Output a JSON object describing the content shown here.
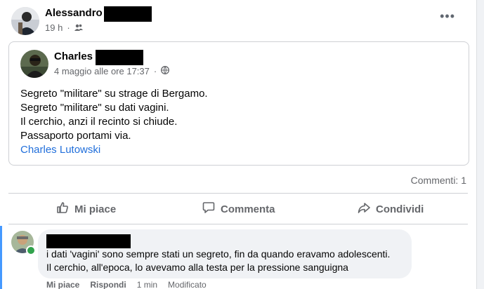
{
  "post": {
    "author": "Alessandro",
    "time": "19 h",
    "audience_icon": "friends-icon",
    "more_label": "•••"
  },
  "shared": {
    "author": "Charles",
    "time": "4 maggio alle ore 17:37",
    "audience_icon": "globe-icon",
    "lines": [
      "Segreto \"militare\" su strage di Bergamo.",
      "Segreto \"militare\" su dati vagini.",
      "Il cerchio, anzi il recinto si chiude.",
      "Passaporto portami via."
    ],
    "link": "Charles Lutowski"
  },
  "stats": {
    "comments": "Commenti: 1"
  },
  "actions": {
    "like": "Mi piace",
    "comment": "Commenta",
    "share": "Condividi"
  },
  "comment": {
    "lines": [
      "i dati 'vagini' sono sempre stati un segreto, fin da quando eravamo adolescenti.",
      "Il cerchio, all'epoca, lo avevamo alla testa per la pressione sanguigna"
    ],
    "like": "Mi piace",
    "reply": "Rispondi",
    "time": "1 min",
    "edited": "Modificato"
  },
  "colors": {
    "accent": "#216fdb",
    "online": "#31a24c",
    "highlight": "#4599ff"
  }
}
